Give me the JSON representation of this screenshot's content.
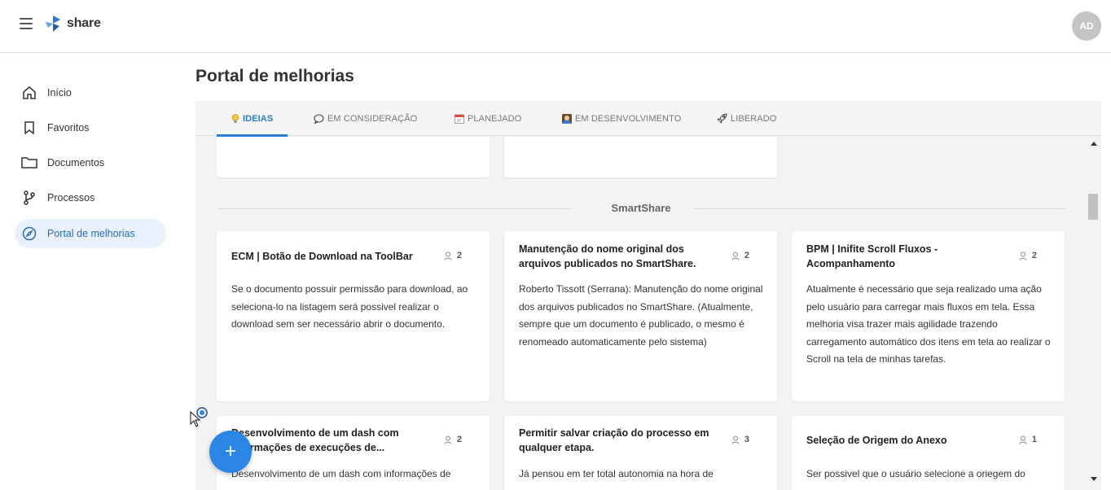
{
  "app": {
    "logo_text": "share",
    "avatar_initials": "AD",
    "brand_color": "#2a7bd1",
    "fab_color": "#2b86e6"
  },
  "sidebar": {
    "items": [
      {
        "label": "Início",
        "icon": "home-icon",
        "active": false
      },
      {
        "label": "Favoritos",
        "icon": "bookmark-icon",
        "active": false
      },
      {
        "label": "Documentos",
        "icon": "folder-icon",
        "active": false
      },
      {
        "label": "Processos",
        "icon": "branch-icon",
        "active": false
      },
      {
        "label": "Portal de melhorias",
        "icon": "compass-icon",
        "active": true
      }
    ]
  },
  "page": {
    "title": "Portal de melhorias"
  },
  "tabs": [
    {
      "label": "IDEIAS",
      "icon": "lightbulb-icon",
      "active": true
    },
    {
      "label": "EM CONSIDERAÇÃO",
      "icon": "speech-bubble-icon",
      "active": false
    },
    {
      "label": "PLANEJADO",
      "icon": "calendar-icon",
      "active": false
    },
    {
      "label": "EM DESENVOLVIMENTO",
      "icon": "developer-icon",
      "active": false
    },
    {
      "label": "LIBERADO",
      "icon": "rocket-icon",
      "active": false
    }
  ],
  "section": {
    "title": "SmartShare"
  },
  "cards": [
    {
      "title": "ECM | Botão de Download na ToolBar",
      "votes": "2",
      "description": "Se o documento possuir permissão para download, ao seleciona-lo na listagem será possivel realizar o download sem ser necessário abrir o documento."
    },
    {
      "title": "Manutenção do nome original dos arquivos publicados no SmartShare.",
      "votes": "2",
      "description": "Roberto Tissott (Serrana): Manutenção do nome original dos arquivos publicados no SmartShare. (Atualmente, sempre que um documento é publicado, o mesmo é renomeado automaticamente pelo sistema)"
    },
    {
      "title": "BPM | Inifite Scroll Fluxos - Acompanhamento",
      "votes": "2",
      "description": "Atualmente é necessário que seja realizado uma ação pelo usuário para carregar mais fluxos em tela. Essa melhoria visa trazer mais agilidade trazendo carregamento automático dos itens em tela ao realizar o Scroll na tela de minhas tarefas."
    },
    {
      "title": "Desenvolvimento de um dash com informações de execuções de...",
      "votes": "2",
      "description": "Desenvolvimento de um dash com informações de"
    },
    {
      "title": "Permitir salvar criação do processo em qualquer etapa.",
      "votes": "3",
      "description": "Já pensou em ter total autonomia na hora de"
    },
    {
      "title": "Seleção de Origem do Anexo",
      "votes": "1",
      "description": "Ser possivel que o usuário selecione a oriegem do"
    }
  ],
  "fab": {
    "label": "+"
  }
}
